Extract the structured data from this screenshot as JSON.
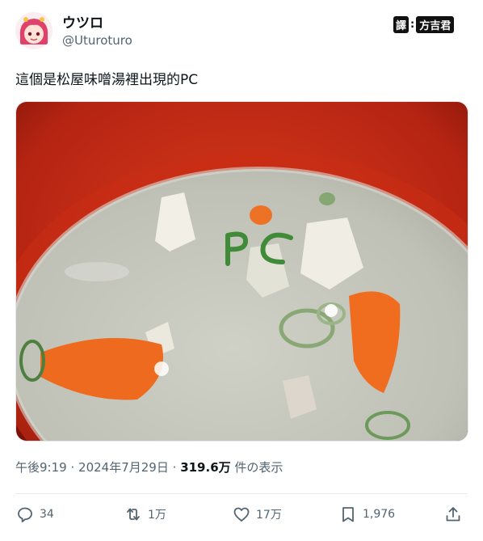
{
  "author": {
    "display_name": "ウツロ",
    "handle": "@Uturoturo",
    "avatar_icon": "anime-girl-avatar"
  },
  "translation_badge": {
    "label": "譯",
    "separator": ":",
    "translator": "方吉君"
  },
  "tweet": {
    "text": "這個是松屋味噌湯裡出現的PC",
    "photo_icon": "miso-soup-photo"
  },
  "meta": {
    "time": "午後9:19",
    "dot1": "·",
    "date": "2024年7月29日",
    "dot2": "·",
    "views": "319.6万",
    "views_suffix": "件の表示"
  },
  "actions": {
    "replies": "34",
    "retweets": "1万",
    "likes": "17万",
    "bookmarks": "1,976"
  },
  "colors": {
    "bowl_red": "#b8200e",
    "soup": "#c4c6bc",
    "carrot": "#ef6a1f",
    "scallion": "#4b8a3a",
    "text_secondary": "#536471"
  }
}
